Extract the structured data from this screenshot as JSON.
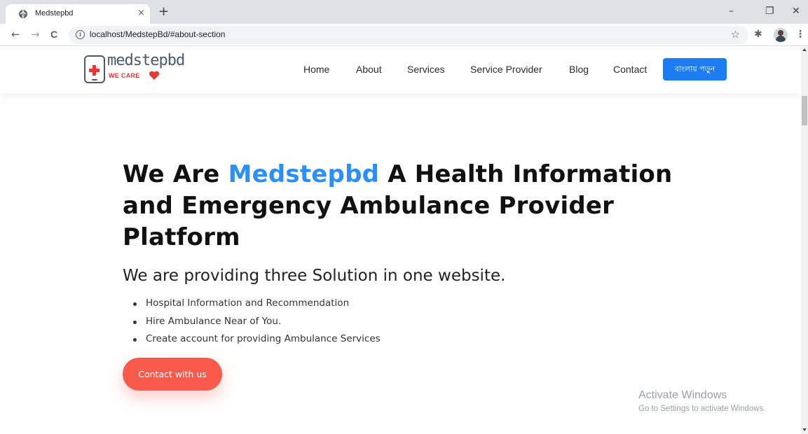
{
  "browser": {
    "tab_title": "Medstepbd",
    "tab_close": "×",
    "new_tab": "+",
    "url": "localhost/MedstepBd/#about-section",
    "window_controls": {
      "minimize": "–",
      "restore": "❐",
      "close": "✕"
    },
    "nav": {
      "back": "←",
      "forward": "→",
      "reload": "C"
    },
    "icons": [
      "favicon-globe-icon",
      "info-icon",
      "star-icon",
      "extensions-icon",
      "profile-avatar",
      "menu-icon"
    ]
  },
  "site": {
    "logo": {
      "name": "medstepbd",
      "tagline": "WE CARE",
      "accent": "#e53935"
    },
    "nav": [
      {
        "label": "Home"
      },
      {
        "label": "About"
      },
      {
        "label": "Services"
      },
      {
        "label": "Service Provider"
      },
      {
        "label": "Blog"
      },
      {
        "label": "Contact"
      }
    ],
    "cta": {
      "label": "বাংলায় পড়ুন",
      "color": "#1e7cf2"
    }
  },
  "hero": {
    "title_prefix": "We Are ",
    "title_brand": "Medstepbd",
    "title_suffix": " A Health Information and Emergency Ambulance Provider Platform",
    "brand_color": "#2a8ff7",
    "subtitle": "We are providing three Solution in one website.",
    "features": [
      "Hospital Information and Recommendation",
      "Hire Ambulance Near of You.",
      "Create account for providing Ambulance Services"
    ],
    "button": {
      "label": "Contact with us",
      "color": "#fa5a4b"
    }
  },
  "watermark": {
    "title": "Activate Windows",
    "subtitle": "Go to Settings to activate Windows."
  }
}
